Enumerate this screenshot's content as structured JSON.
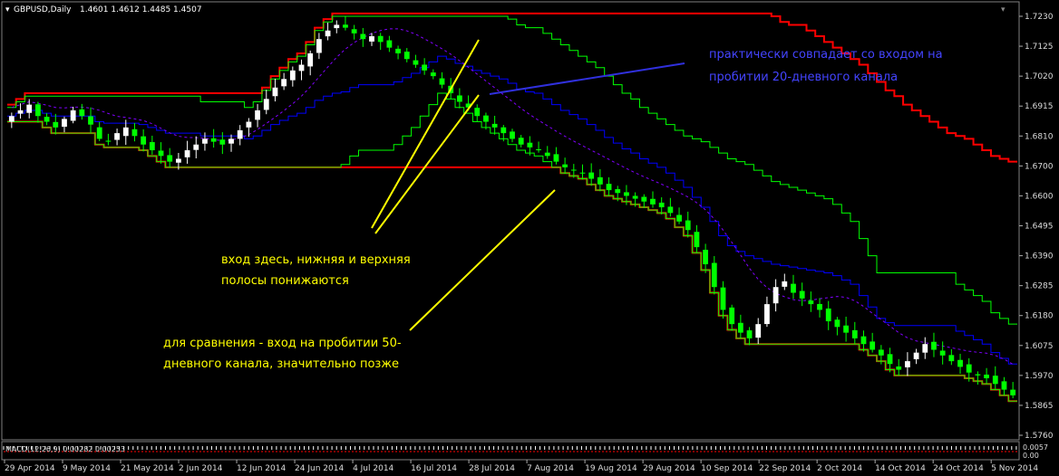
{
  "header": {
    "symbol": "GBPUSD,Daily",
    "ohlc": "1.4601 1.4612 1.4485 1.4507"
  },
  "price_axis": {
    "ticks": [
      "1.7230",
      "1.7125",
      "1.7020",
      "1.6915",
      "1.6810",
      "1.6700",
      "1.6600",
      "1.6495",
      "1.6390",
      "1.6285",
      "1.6180",
      "1.6075",
      "1.5970",
      "1.5865",
      "1.5760"
    ]
  },
  "date_axis": {
    "ticks": [
      "29 Apr 2014",
      "9 May 2014",
      "21 May 2014",
      "2 Jun 2014",
      "12 Jun 2014",
      "24 Jun 2014",
      "4 Jul 2014",
      "16 Jul 2014",
      "28 Jul 2014",
      "7 Aug 2014",
      "19 Aug 2014",
      "29 Aug 2014",
      "10 Sep 2014",
      "22 Sep 2014",
      "2 Oct 2014",
      "14 Oct 2014",
      "24 Oct 2014",
      "5 Nov 2014"
    ]
  },
  "macd": {
    "label": "MACD(12,26,9) 0.00282 0.00253",
    "ticks": [
      "0.0057",
      "0.00"
    ]
  },
  "annotations": {
    "blue_note": [
      "практически совпадает со входом на",
      "пробитии 20-дневного канала"
    ],
    "entry_note": [
      "вход здесь, нижняя и верхняя",
      "полосы понижаются"
    ],
    "compare_note": [
      "для сравнения - вход на пробитии 50-",
      "дневного канала, значительно позже"
    ]
  },
  "colors": {
    "background": "#000000",
    "bull_candle": "#ffffff",
    "bear_candle": "#00ff00",
    "channel_50": "#ff0000",
    "channel_20": "#00ff00",
    "middle_line": "#0000ff",
    "dashed": "#8000ff",
    "annotation_yellow": "#ffff00",
    "annotation_blue": "#4444ff"
  },
  "chart_data": {
    "type": "candlestick",
    "title": "GBPUSD,Daily",
    "ylim": [
      1.576,
      1.723
    ],
    "close_approx": [
      1.688,
      1.69,
      1.692,
      1.688,
      1.686,
      1.684,
      1.687,
      1.69,
      1.688,
      1.685,
      1.68,
      1.679,
      1.682,
      1.684,
      1.681,
      1.678,
      1.676,
      1.674,
      1.672,
      1.673,
      1.676,
      1.678,
      1.68,
      1.679,
      1.678,
      1.68,
      1.683,
      1.686,
      1.69,
      1.694,
      1.698,
      1.701,
      1.704,
      1.706,
      1.71,
      1.715,
      1.718,
      1.72,
      1.719,
      1.717,
      1.715,
      1.716,
      1.714,
      1.712,
      1.71,
      1.708,
      1.706,
      1.704,
      1.702,
      1.699,
      1.696,
      1.693,
      1.691,
      1.688,
      1.686,
      1.684,
      1.682,
      1.68,
      1.678,
      1.677,
      1.676,
      1.674,
      1.672,
      1.67,
      1.669,
      1.668,
      1.666,
      1.664,
      1.662,
      1.661,
      1.66,
      1.659,
      1.658,
      1.657,
      1.656,
      1.654,
      1.651,
      1.648,
      1.642,
      1.636,
      1.628,
      1.62,
      1.615,
      1.612,
      1.61,
      1.615,
      1.622,
      1.628,
      1.63,
      1.626,
      1.624,
      1.622,
      1.62,
      1.616,
      1.614,
      1.612,
      1.61,
      1.608,
      1.606,
      1.604,
      1.601,
      1.599,
      1.602,
      1.605,
      1.608,
      1.606,
      1.604,
      1.602,
      1.6,
      1.598,
      1.597,
      1.596,
      1.594,
      1.592,
      1.59
    ]
  }
}
